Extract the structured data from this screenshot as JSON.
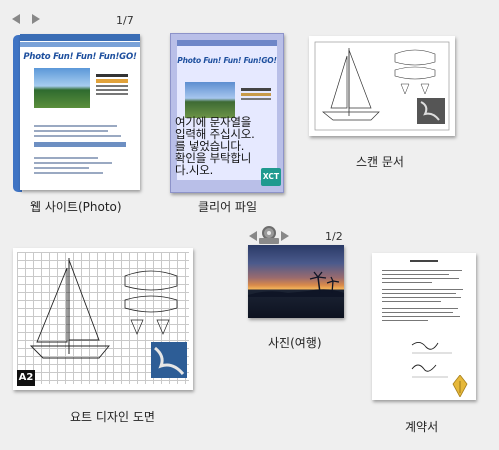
{
  "items": {
    "website": {
      "label": "웹 사이트(Photo)",
      "counter": "1/7",
      "page_title": "Photo Fun! Fun! Fun!GO!"
    },
    "clear_file": {
      "label": "클리어 파일",
      "overlay_text": "여기에 문자열을\n입력해 주십시오.\n를 넣었습니다.\n확인을 부탁합니\n다.시오.",
      "badge": "XCT",
      "page_title": "Photo Fun! Fun! Fun!GO!"
    },
    "scan_doc": {
      "label": "스캔 문서"
    },
    "yacht_design": {
      "label": "요트 디자인 도면",
      "badge": "A2"
    },
    "photo_travel": {
      "label": "사진(여행)",
      "counter": "1/2"
    },
    "contract": {
      "label": "계약서"
    }
  }
}
